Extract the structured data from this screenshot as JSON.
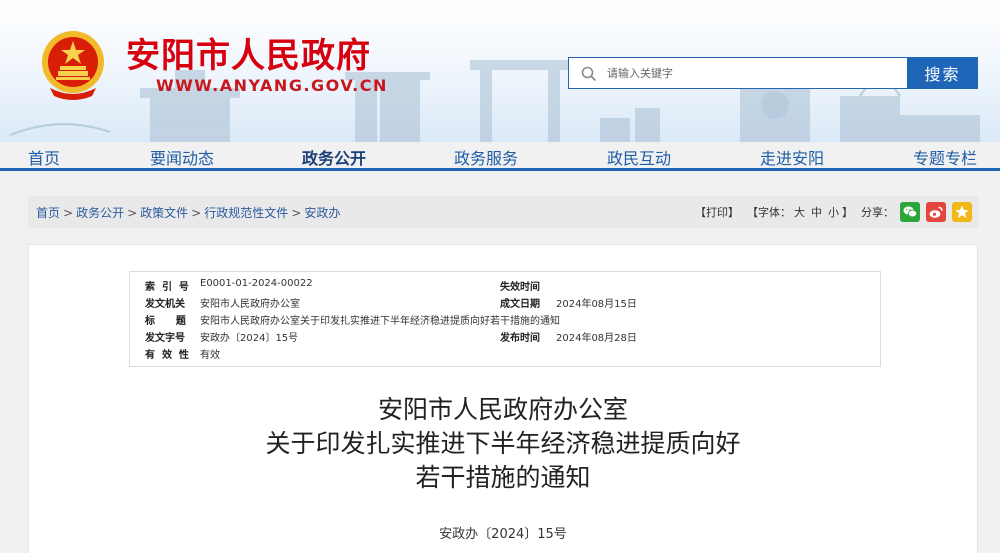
{
  "header": {
    "site_title": "安阳市人民政府",
    "site_url": "WWW.ANYANG.GOV.CN",
    "search_placeholder": "请输入关键字",
    "search_button": "搜索"
  },
  "nav": {
    "items": [
      {
        "label": "首页"
      },
      {
        "label": "要闻动态"
      },
      {
        "label": "政务公开",
        "active": true
      },
      {
        "label": "政务服务"
      },
      {
        "label": "政民互动"
      },
      {
        "label": "走进安阳"
      },
      {
        "label": "专题专栏"
      }
    ]
  },
  "breadcrumb": {
    "items": [
      "首页",
      "政务公开",
      "政策文件",
      "行政规范性文件",
      "安政办"
    ],
    "separator": ">"
  },
  "tools": {
    "print": "【打印】",
    "font_open": "【字体：",
    "font_large": "大",
    "font_medium": "中",
    "font_small": "小",
    "font_close": "】",
    "share_label": "分享：",
    "share_icons": [
      "wechat-icon",
      "weibo-icon",
      "favorite-star-icon"
    ],
    "colors": {
      "wechat": "#2ca638",
      "weibo": "#e2463f",
      "star": "#f2b818"
    }
  },
  "meta": {
    "index_label": "索  引  号",
    "index_value": "E0001-01-2024-00022",
    "valid_time_label": "失效时间",
    "valid_time_value": "",
    "issuer_label": "发文机关",
    "issuer_value": "安阳市人民政府办公室",
    "written_date_label": "成文日期",
    "written_date_value": "2024年08月15日",
    "title_label": "标      题",
    "title_value": "安阳市人民政府办公室关于印发扎实推进下半年经济稳进提质向好若干措施的通知",
    "doc_no_label": "发文字号",
    "doc_no_value": "安政办〔2024〕15号",
    "publish_date_label": "发布时间",
    "publish_date_value": "2024年08月28日",
    "validity_label": "有  效  性",
    "validity_value": "有效"
  },
  "document": {
    "title_line1": "安阳市人民政府办公室",
    "title_line2": "关于印发扎实推进下半年经济稳进提质向好",
    "title_line3": "若干措施的通知",
    "number": "安政办〔2024〕15号"
  },
  "colors": {
    "brand_red": "#d7000f",
    "brand_blue": "#1e65b8"
  }
}
